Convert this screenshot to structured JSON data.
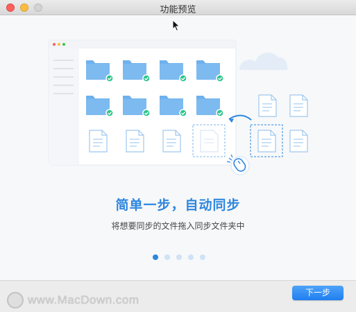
{
  "window": {
    "title": "功能预览"
  },
  "slide": {
    "heading": "简单一步，自动同步",
    "description": "将想要同步的文件拖入同步文件夹中",
    "pages": [
      {
        "active": true
      },
      {
        "active": false
      },
      {
        "active": false
      },
      {
        "active": false
      },
      {
        "active": false
      }
    ]
  },
  "footer": {
    "next_label": "下一步",
    "watermark": "www.MacDown.com"
  },
  "colors": {
    "accent": "#2e86de",
    "folder": "#6fb1ec",
    "check": "#2bc48a",
    "doc_outline": "#9ec7ee"
  },
  "icons": [
    "close-icon",
    "minimize-icon",
    "maximize-icon",
    "folder-icon",
    "check-icon",
    "document-icon",
    "mouse-icon",
    "cloud-icon",
    "arrow-icon",
    "cursor-icon"
  ]
}
